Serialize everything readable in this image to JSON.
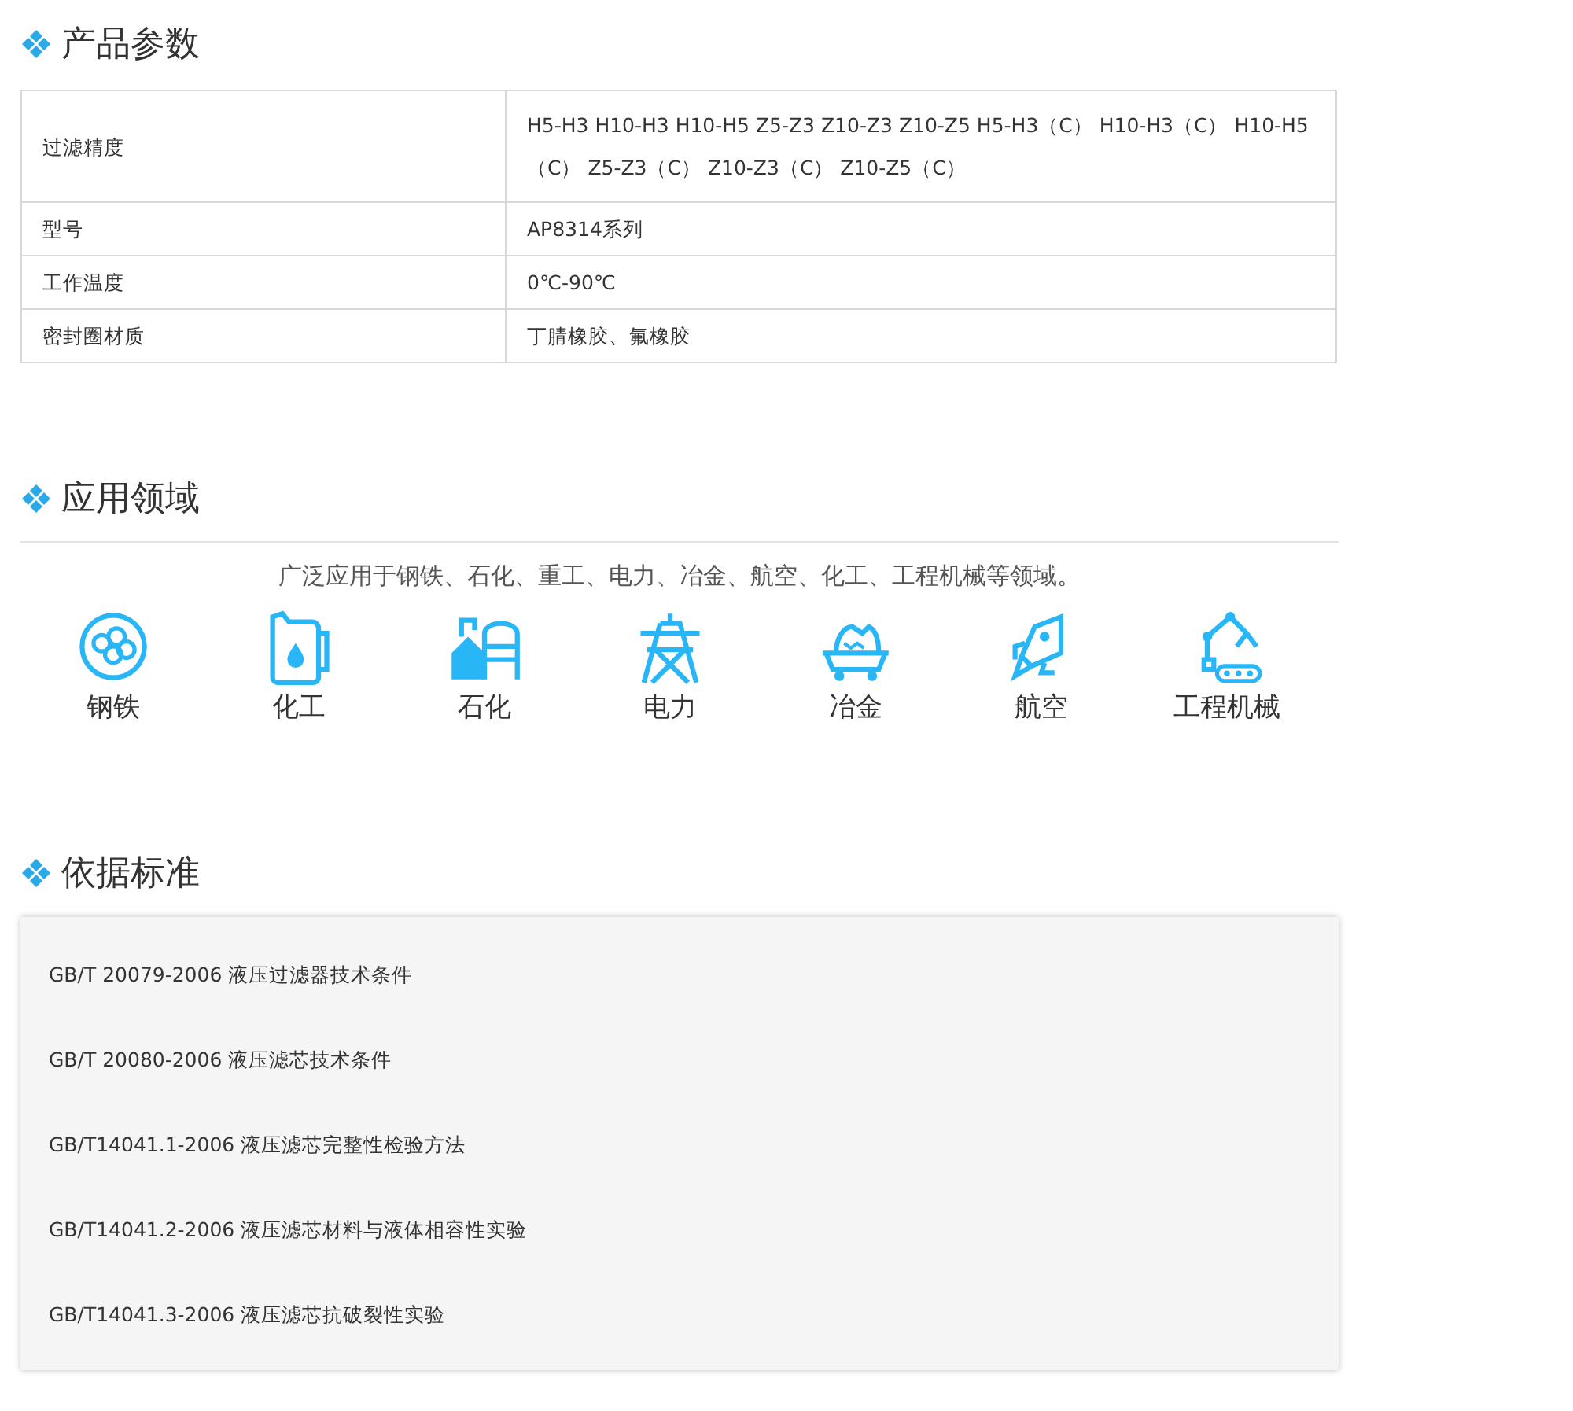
{
  "params": {
    "title": "产品参数",
    "rows": [
      {
        "label": "过滤精度",
        "value": "H5-H3 H10-H3 H10-H5 Z5-Z3 Z10-Z3 Z10-Z5 H5-H3（C） H10-H3（C） H10-H5（C） Z5-Z3（C） Z10-Z3（C） Z10-Z5（C）"
      },
      {
        "label": "型号",
        "value": "AP8314系列"
      },
      {
        "label": "工作温度",
        "value": "0℃-90℃"
      },
      {
        "label": "密封圈材质",
        "value": "丁腈橡胶、氟橡胶"
      }
    ]
  },
  "applications": {
    "title": "应用领域",
    "intro": "广泛应用于钢铁、石化、重工、电力、冶金、航空、化工、工程机械等领域。",
    "items": [
      {
        "kind": "steel",
        "label": "钢铁"
      },
      {
        "kind": "chemical",
        "label": "化工"
      },
      {
        "kind": "petrochem",
        "label": "石化"
      },
      {
        "kind": "power",
        "label": "电力"
      },
      {
        "kind": "metallurgy",
        "label": "冶金"
      },
      {
        "kind": "aviation",
        "label": "航空"
      },
      {
        "kind": "machinery",
        "label": "工程机械"
      }
    ]
  },
  "standards": {
    "title": "依据标准",
    "items": [
      "GB/T 20079-2006 液压过滤器技术条件",
      "GB/T 20080-2006 液压滤芯技术条件",
      "GB/T14041.1-2006 液压滤芯完整性检验方法",
      "GB/T14041.2-2006 液压滤芯材料与液体相容性实验",
      "GB/T14041.3-2006 液压滤芯抗破裂性实验"
    ]
  }
}
